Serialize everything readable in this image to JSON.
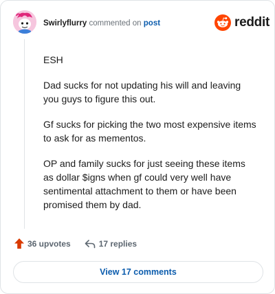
{
  "comment": {
    "username": "Swirlyflurry",
    "commented_on": "commented on",
    "post_link": "post",
    "paragraphs": [
      "ESH",
      "Dad sucks for not updating his will and leaving you guys to figure this out.",
      "Gf sucks for picking the two most expensive items to ask for as mementos.",
      "OP and family sucks for just seeing these items as dollar $igns when gf could very well have sentimental attachment to them or have been promised them by dad."
    ]
  },
  "brand": {
    "name": "reddit",
    "color": "#ff4500"
  },
  "actions": {
    "upvotes": "36 upvotes",
    "replies": "17 replies"
  },
  "view_comments_label": "View 17 comments",
  "colors": {
    "link": "#0b5cad",
    "upvote": "#d93a00",
    "border": "#dfe3e6"
  }
}
